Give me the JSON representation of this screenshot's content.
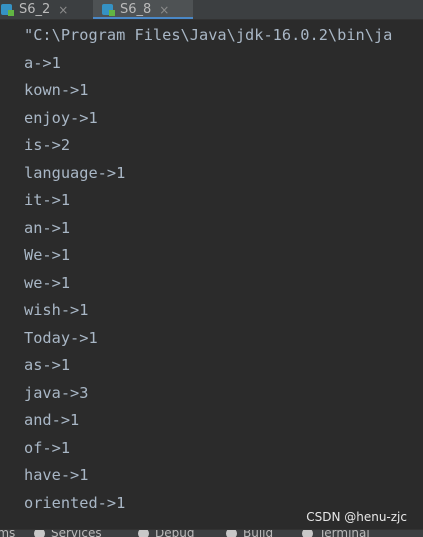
{
  "tabs": [
    {
      "label": "S6_2",
      "close": "×",
      "active": false
    },
    {
      "label": "S6_8",
      "close": "×",
      "active": true
    }
  ],
  "console": {
    "lines": [
      "\"C:\\Program Files\\Java\\jdk-16.0.2\\bin\\ja",
      "a->1",
      "kown->1",
      "enjoy->1",
      "is->2",
      "language->1",
      "it->1",
      "an->1",
      "We->1",
      "we->1",
      "wish->1",
      "Today->1",
      "as->1",
      "java->3",
      "and->1",
      "of->1",
      "have->1",
      "oriented->1"
    ]
  },
  "watermark": "CSDN @henu-zjc",
  "bottom_bar": {
    "items": [
      "Problems",
      "Services",
      "Debug",
      "Build",
      "Terminal"
    ]
  },
  "colors": {
    "background": "#2b2b2b",
    "tab_bar": "#3c3f41",
    "active_tab": "#4e5254",
    "active_tab_underline": "#4a88c7",
    "console_text": "#a9b7c6"
  }
}
